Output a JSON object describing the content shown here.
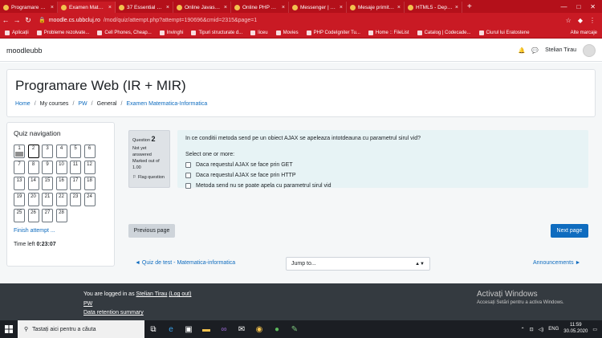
{
  "browser": {
    "tabs": [
      {
        "label": "Programare Web",
        "active": false
      },
      {
        "label": "Examen Matemati",
        "active": true
      },
      {
        "label": "37 Essential JavaS",
        "active": false
      },
      {
        "label": "Online Javascript",
        "active": false
      },
      {
        "label": "Online PHP Editor",
        "active": false
      },
      {
        "label": "Messenger | Faceb",
        "active": false
      },
      {
        "label": "Mesaje primite (6",
        "active": false
      },
      {
        "label": "HTML5 - Depreca",
        "active": false
      }
    ],
    "new_tab": "+",
    "window_controls": [
      "—",
      "□",
      "✕"
    ],
    "url_host": "moodle.cs.ubbcluj.ro",
    "url_path": "/mod/quiz/attempt.php?attempt=190696&cmid=2315&page=1",
    "bookmarks": [
      "Aplicații",
      "Probleme rezolvate...",
      "Cell Phones, Cheap...",
      "Invinghi",
      "Tipuri structurate d...",
      "liceu",
      "Movies",
      "PHP CodeIgniter Tu...",
      "Home :: FileList",
      "Catalog | Codecade...",
      "Ciurul lui Eratostene"
    ],
    "other_bookmarks": "Alte marcaje"
  },
  "moodle": {
    "brand": "moodleubb",
    "user_name": "Stelian Tirau"
  },
  "header": {
    "title": "Programare Web (IR + MIR)",
    "breadcrumb": [
      "Home",
      "My courses",
      "PW",
      "General",
      "Examen Matematica-Informatica"
    ]
  },
  "quiz_nav": {
    "title": "Quiz navigation",
    "questions": [
      "1",
      "2",
      "3",
      "4",
      "5",
      "6",
      "7",
      "8",
      "9",
      "10",
      "11",
      "12",
      "13",
      "14",
      "15",
      "16",
      "17",
      "18",
      "19",
      "20",
      "21",
      "22",
      "23",
      "24",
      "25",
      "26",
      "27",
      "28"
    ],
    "current": "2",
    "finish_label": "Finish attempt ...",
    "time_left_label": "Time left",
    "time_left_value": "0:23:07"
  },
  "question": {
    "label": "Question",
    "number": "2",
    "status": "Not yet answered",
    "marked": "Marked out of 1.00",
    "flag": "Flag question",
    "text": "In ce conditii metoda send pe un obiect AJAX se apeleaza intotdeauna cu parametrul sirul vid?",
    "select_label": "Select one or more:",
    "options": [
      "Daca requestul AJAX se face prin GET",
      "Daca requestul AJAX se face prin HTTP",
      "Metoda send nu se poate apela cu parametrul sirul vid"
    ]
  },
  "nav_buttons": {
    "previous": "Previous page",
    "next": "Next page",
    "prev_activity": "◄ Quiz de test - Matematica-informatica",
    "jump": "Jump to...",
    "next_activity": "Announcements ►"
  },
  "footer": {
    "logged_in_prefix": "You are logged in as",
    "user": "Stelian Tirau",
    "logout": "(Log out)",
    "course": "PW",
    "retention": "Data retention summary"
  },
  "windows_activation": {
    "title": "Activați Windows",
    "subtitle": "Accesați Setări pentru a activa Windows."
  },
  "taskbar": {
    "search_placeholder": "Tastați aici pentru a căuta",
    "language": "ENG",
    "time": "11:59",
    "date": "30.05.2020"
  }
}
